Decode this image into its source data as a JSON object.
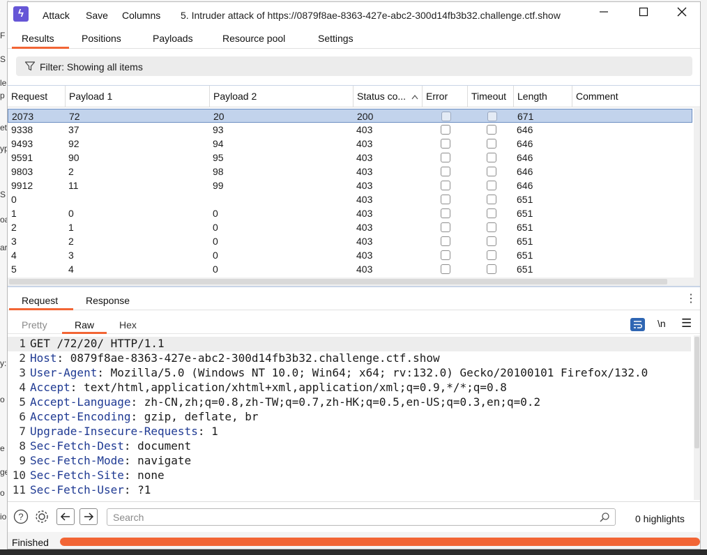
{
  "window": {
    "menu": [
      "Attack",
      "Save",
      "Columns"
    ],
    "title": "5. Intruder attack of https://0879f8ae-8363-427e-abc2-300d14fb3b32.challenge.ctf.show"
  },
  "tabs": [
    "Results",
    "Positions",
    "Payloads",
    "Resource pool",
    "Settings"
  ],
  "filter": {
    "label": "Filter: Showing all items"
  },
  "table": {
    "columns": [
      "Request",
      "Payload 1",
      "Payload 2",
      "Status co...",
      "Error",
      "Timeout",
      "Length",
      "Comment"
    ],
    "rows": [
      {
        "request": "2073",
        "p1": "72",
        "p2": "20",
        "status": "200",
        "length": "671"
      },
      {
        "request": "9338",
        "p1": "37",
        "p2": "93",
        "status": "403",
        "length": "646"
      },
      {
        "request": "9493",
        "p1": "92",
        "p2": "94",
        "status": "403",
        "length": "646"
      },
      {
        "request": "9591",
        "p1": "90",
        "p2": "95",
        "status": "403",
        "length": "646"
      },
      {
        "request": "9803",
        "p1": "2",
        "p2": "98",
        "status": "403",
        "length": "646"
      },
      {
        "request": "9912",
        "p1": "11",
        "p2": "99",
        "status": "403",
        "length": "646"
      },
      {
        "request": "0",
        "p1": "",
        "p2": "",
        "status": "403",
        "length": "651"
      },
      {
        "request": "1",
        "p1": "0",
        "p2": "0",
        "status": "403",
        "length": "651"
      },
      {
        "request": "2",
        "p1": "1",
        "p2": "0",
        "status": "403",
        "length": "651"
      },
      {
        "request": "3",
        "p1": "2",
        "p2": "0",
        "status": "403",
        "length": "651"
      },
      {
        "request": "4",
        "p1": "3",
        "p2": "0",
        "status": "403",
        "length": "651"
      },
      {
        "request": "5",
        "p1": "4",
        "p2": "0",
        "status": "403",
        "length": "651"
      }
    ]
  },
  "rr_tabs": [
    "Request",
    "Response"
  ],
  "view_tabs": [
    "Pretty",
    "Raw",
    "Hex"
  ],
  "newline_toggle": "\\n",
  "editor": {
    "lines": [
      {
        "num": "1",
        "name": "",
        "value": "GET /72/20/ HTTP/1.1"
      },
      {
        "num": "2",
        "name": "Host",
        "value": ": 0879f8ae-8363-427e-abc2-300d14fb3b32.challenge.ctf.show"
      },
      {
        "num": "3",
        "name": "User-Agent",
        "value": ": Mozilla/5.0 (Windows NT 10.0; Win64; x64; rv:132.0) Gecko/20100101 Firefox/132.0"
      },
      {
        "num": "4",
        "name": "Accept",
        "value": ": text/html,application/xhtml+xml,application/xml;q=0.9,*/*;q=0.8"
      },
      {
        "num": "5",
        "name": "Accept-Language",
        "value": ": zh-CN,zh;q=0.8,zh-TW;q=0.7,zh-HK;q=0.5,en-US;q=0.3,en;q=0.2"
      },
      {
        "num": "6",
        "name": "Accept-Encoding",
        "value": ": gzip, deflate, br"
      },
      {
        "num": "7",
        "name": "Upgrade-Insecure-Requests",
        "value": ": 1"
      },
      {
        "num": "8",
        "name": "Sec-Fetch-Dest",
        "value": ": document"
      },
      {
        "num": "9",
        "name": "Sec-Fetch-Mode",
        "value": ": navigate"
      },
      {
        "num": "10",
        "name": "Sec-Fetch-Site",
        "value": ": none"
      },
      {
        "num": "11",
        "name": "Sec-Fetch-User",
        "value": ": ?1"
      }
    ]
  },
  "search": {
    "placeholder": "Search",
    "highlights": "0 highlights"
  },
  "status": {
    "text": "Finished",
    "progress": 1.0
  },
  "colors": {
    "accent": "#f26535",
    "selection": "#c2d3ec",
    "header_name": "#1f3a93",
    "logo": "#6656d6"
  }
}
